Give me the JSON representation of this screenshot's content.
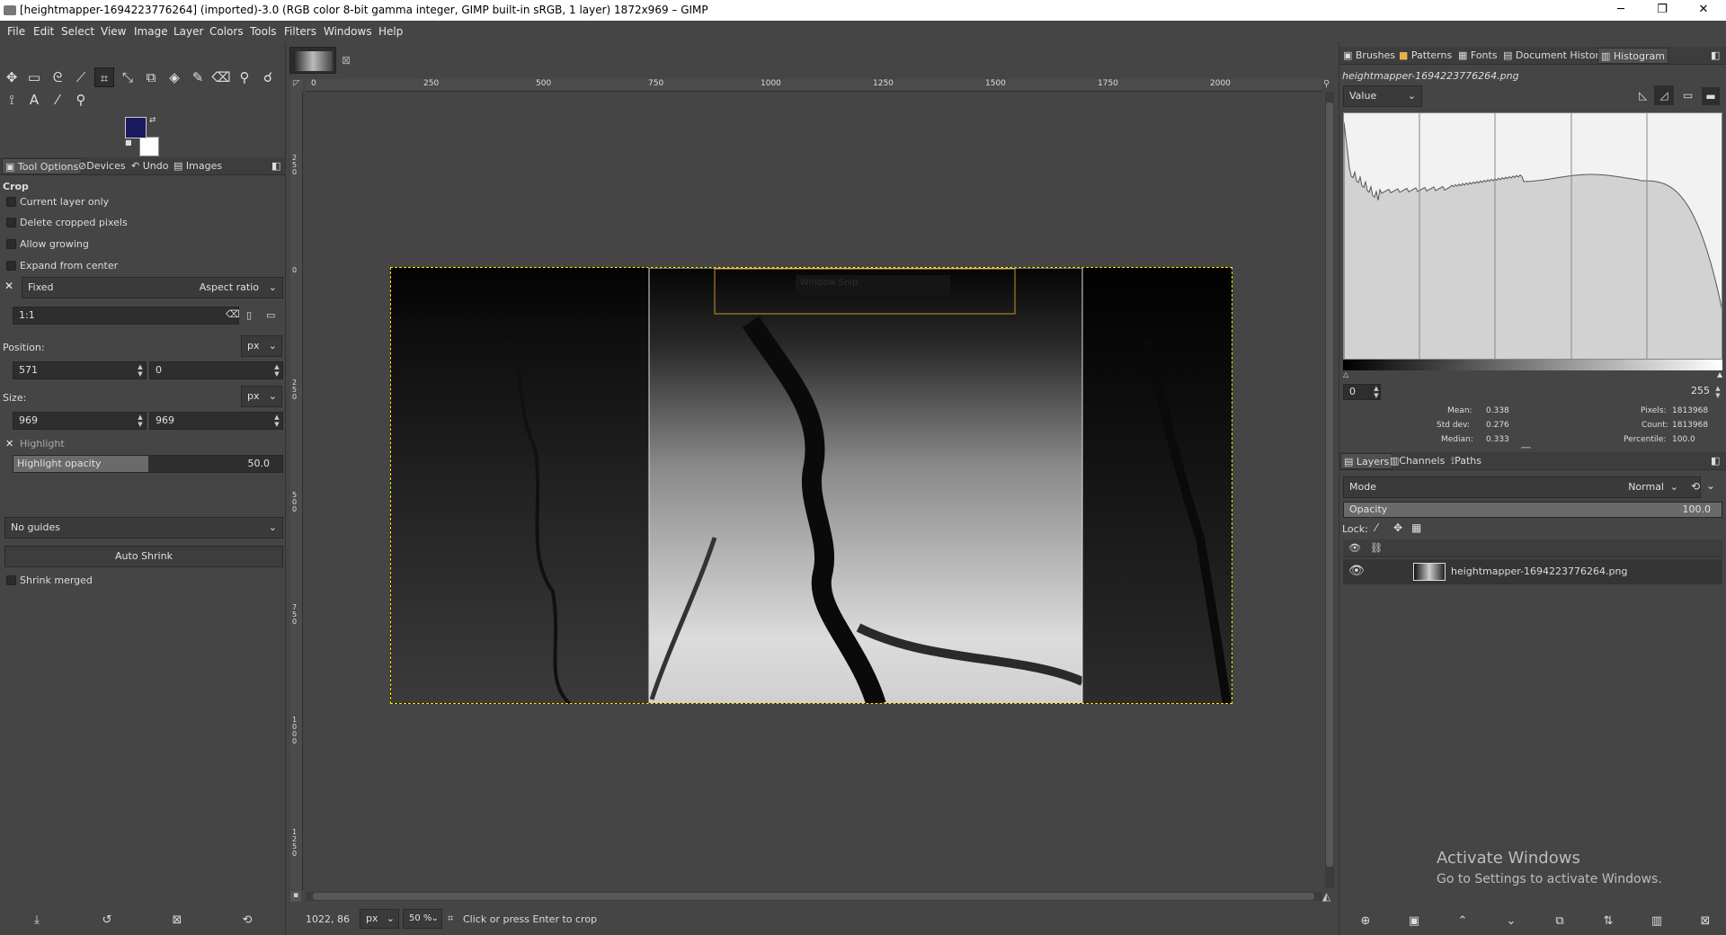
{
  "window": {
    "title": "[heightmapper-1694223776264] (imported)-3.0 (RGB color 8-bit gamma integer, GIMP built-in sRGB, 1 layer) 1872x969 – GIMP",
    "minimize": "─",
    "maximize": "❐",
    "close": "✕"
  },
  "menu": [
    "File",
    "Edit",
    "Select",
    "View",
    "Image",
    "Layer",
    "Colors",
    "Tools",
    "Filters",
    "Windows",
    "Help"
  ],
  "colors": {
    "foreground": "#1a1a5e",
    "background": "#ffffff",
    "selection": "#ffe500"
  },
  "left_tabs": [
    "Tool Options",
    "Devices",
    "Undo",
    "Images"
  ],
  "tool_options": {
    "title": "Crop",
    "current_layer_only": "Current layer only",
    "delete_cropped": "Delete cropped pixels",
    "allow_growing": "Allow growing",
    "expand_from_center": "Expand from center",
    "fixed": "Fixed",
    "aspect_ratio": "Aspect ratio",
    "ratio_value": "1:1",
    "position_label": "Position:",
    "position_unit": "px",
    "position_x": "571",
    "position_y": "0",
    "size_label": "Size:",
    "size_unit": "px",
    "size_w": "969",
    "size_h": "969",
    "highlight": "Highlight",
    "highlight_opacity_label": "Highlight opacity",
    "highlight_opacity_value": "50.0",
    "highlight_opacity_fraction": 0.5,
    "guides": "No guides",
    "auto_shrink": "Auto Shrink",
    "shrink_merged": "Shrink merged"
  },
  "image_tab_close": "⊠",
  "hruler_labels": [
    "0",
    "250",
    "500",
    "750",
    "1000",
    "1250",
    "1500",
    "1750",
    "2000"
  ],
  "vruler_labels": [
    "2 5 0",
    "0",
    "2 5 0",
    "5 0 0",
    "7 5 0",
    "1 0 0 0",
    "1 2 5 0"
  ],
  "snip_label": "Window Snip",
  "right_tabs": [
    "Brushes",
    "Patterns",
    "Fonts",
    "Document History",
    "Histogram"
  ],
  "histogram": {
    "filename": "heightmapper-1694223776264.png",
    "channel": "Value",
    "range_min": "0",
    "range_max": "255",
    "mean_label": "Mean:",
    "mean": "0.338",
    "std_label": "Std dev:",
    "std": "0.276",
    "median_label": "Median:",
    "median": "0.333",
    "pixels_label": "Pixels:",
    "pixels": "1813968",
    "count_label": "Count:",
    "count": "1813968",
    "percentile_label": "Percentile:",
    "percentile": "100.0"
  },
  "layer_tabs": [
    "Layers",
    "Channels",
    "Paths"
  ],
  "layers": {
    "mode_label": "Mode",
    "mode_value": "Normal",
    "opacity_label": "Opacity",
    "opacity_value": "100.0",
    "lock_label": "Lock:",
    "items": [
      {
        "name": "heightmapper-1694223776264.png"
      }
    ]
  },
  "status": {
    "coords": "1022, 86",
    "unit": "px",
    "zoom": "50 %",
    "message": "Click or press Enter to crop"
  },
  "activation": {
    "title": "Activate Windows",
    "subtitle": "Go to Settings to activate Windows."
  }
}
